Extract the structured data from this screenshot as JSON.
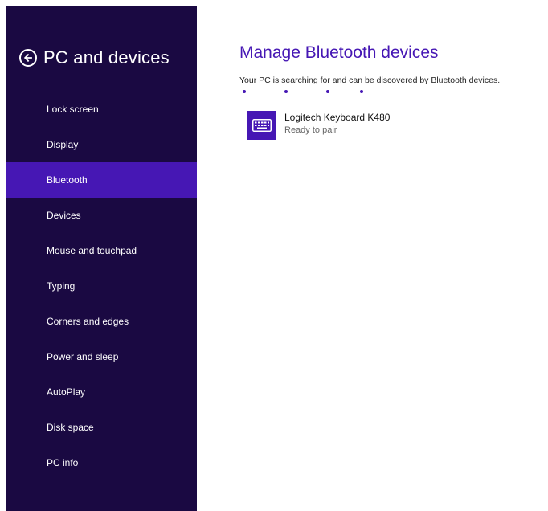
{
  "colors": {
    "sidebar_bg": "#1a0942",
    "accent": "#4617b4",
    "text_dark": "#111111",
    "text_muted": "#666666"
  },
  "sidebar": {
    "back_icon": "arrow-left-circle-icon",
    "title": "PC and devices",
    "items": [
      {
        "label": "Lock screen",
        "selected": false
      },
      {
        "label": "Display",
        "selected": false
      },
      {
        "label": "Bluetooth",
        "selected": true
      },
      {
        "label": "Devices",
        "selected": false
      },
      {
        "label": "Mouse and touchpad",
        "selected": false
      },
      {
        "label": "Typing",
        "selected": false
      },
      {
        "label": "Corners and edges",
        "selected": false
      },
      {
        "label": "Power and sleep",
        "selected": false
      },
      {
        "label": "AutoPlay",
        "selected": false
      },
      {
        "label": "Disk space",
        "selected": false
      },
      {
        "label": "PC info",
        "selected": false
      }
    ]
  },
  "main": {
    "title": "Manage Bluetooth devices",
    "status_text": "Your PC is searching for and can be discovered by Bluetooth devices.",
    "devices": [
      {
        "icon": "keyboard-icon",
        "name": "Logitech Keyboard K480",
        "status": "Ready to pair"
      }
    ]
  }
}
